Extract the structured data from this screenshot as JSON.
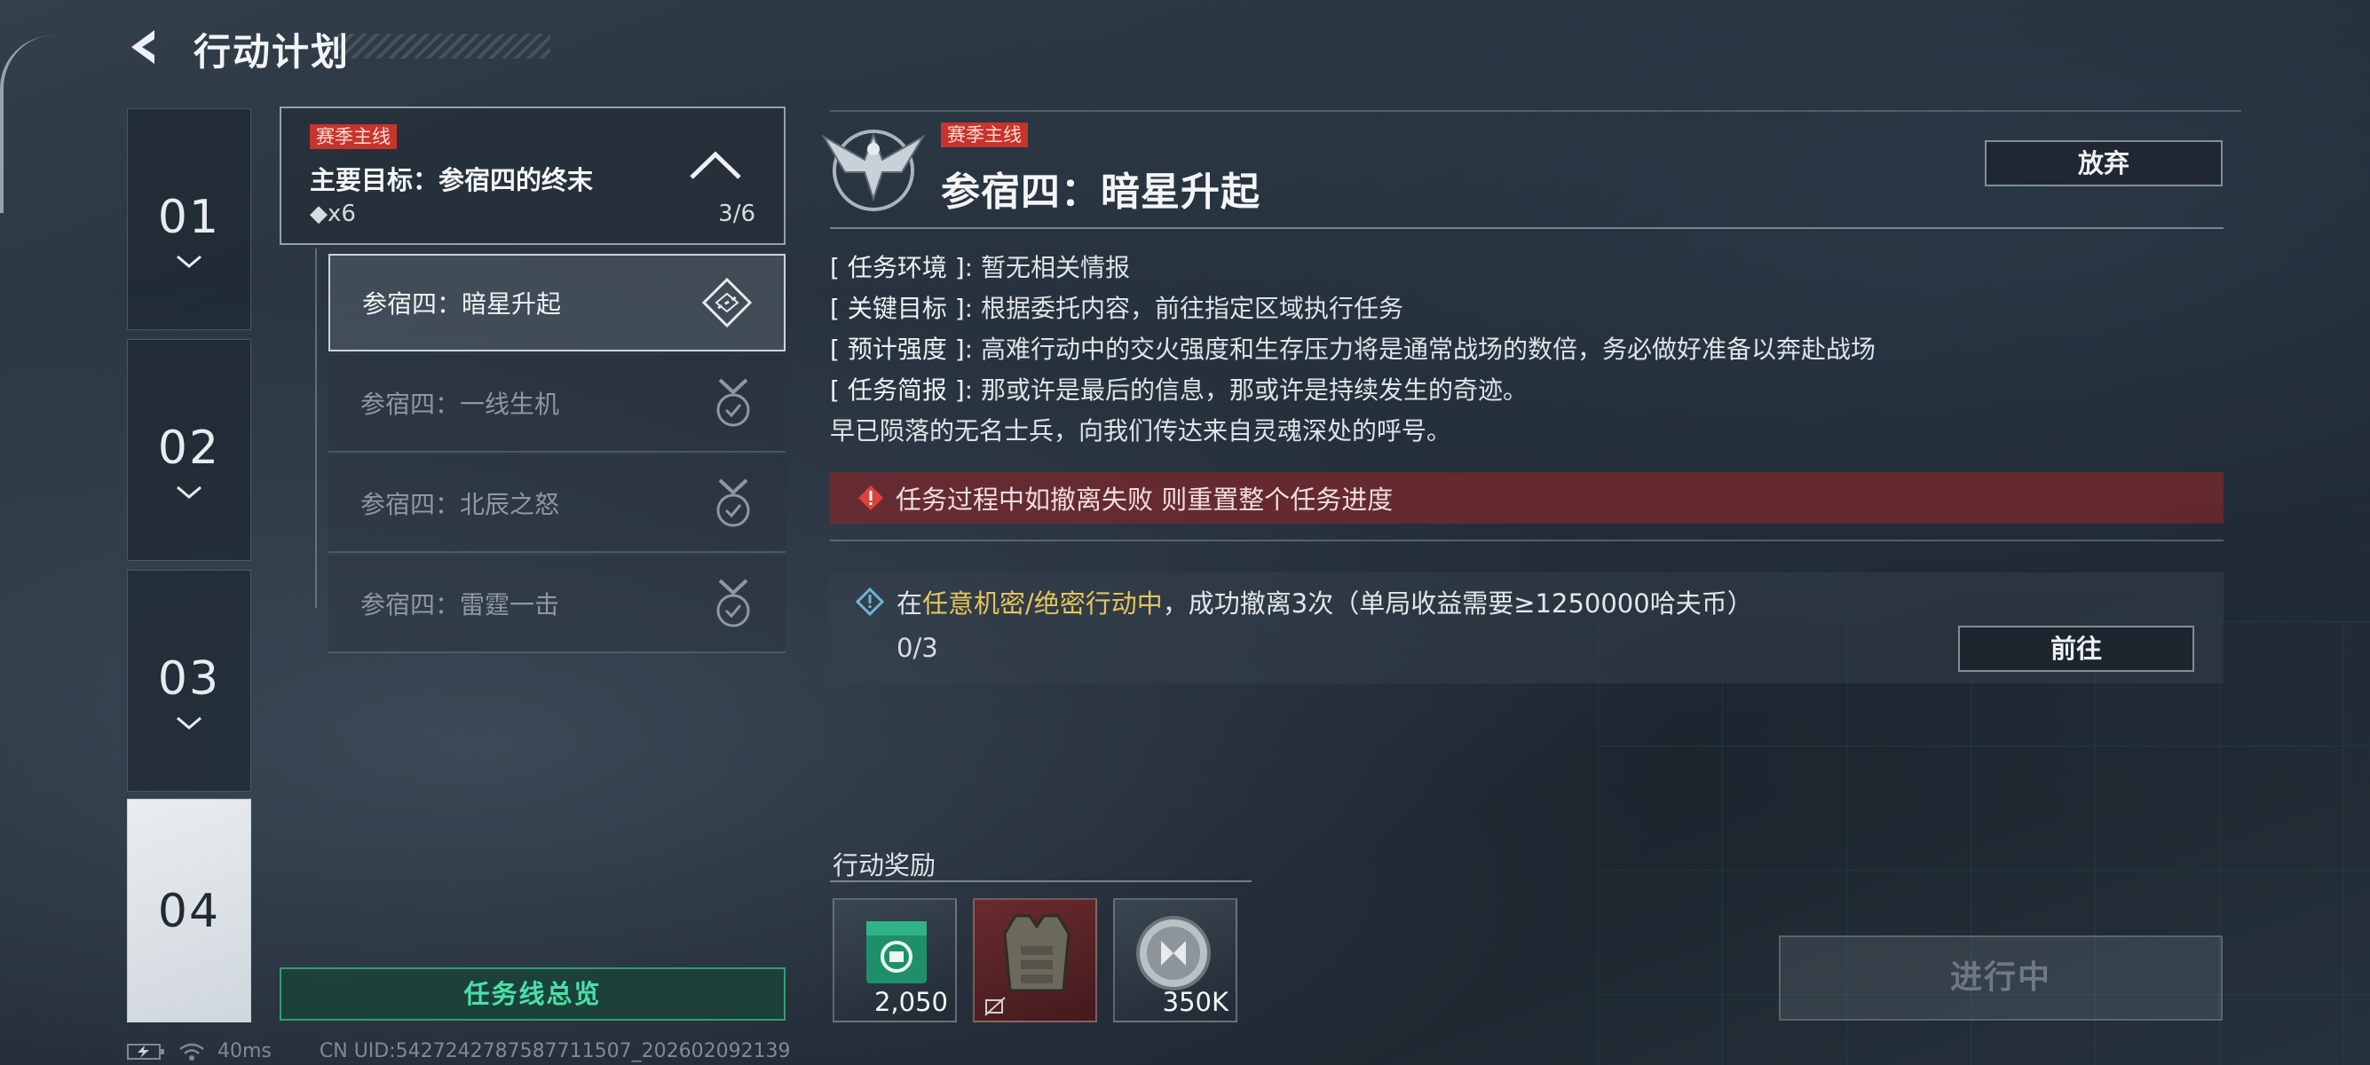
{
  "header": {
    "title": "行动计划"
  },
  "chapters": [
    {
      "label": "01",
      "active": false
    },
    {
      "label": "02",
      "active": false
    },
    {
      "label": "03",
      "active": false
    },
    {
      "label": "04",
      "active": true
    }
  ],
  "main_goal": {
    "tag": "赛季主线",
    "title": "主要目标：参宿四的终末",
    "reward": "◆x6",
    "progress": "3/6"
  },
  "sub_missions": [
    {
      "label": "参宿四：暗星升起",
      "icon": "hazard-diamond-icon",
      "selected": true
    },
    {
      "label": "参宿四：一线生机",
      "icon": "medal-check-icon",
      "selected": false
    },
    {
      "label": "参宿四：北辰之怒",
      "icon": "medal-check-icon",
      "selected": false
    },
    {
      "label": "参宿四：雷霆一击",
      "icon": "medal-check-icon",
      "selected": false
    }
  ],
  "overview_button": "任务线总览",
  "detail": {
    "tag": "赛季主线",
    "name": "参宿四：暗星升起",
    "abandon_label": "放弃",
    "info": [
      {
        "key": "[ 任务环境 ]",
        "value": ": 暂无相关情报"
      },
      {
        "key": "[ 关键目标 ]",
        "value": ": 根据委托内容，前往指定区域执行任务"
      },
      {
        "key": "[ 预计强度 ]",
        "value": ": 高难行动中的交火强度和生存压力将是通常战场的数倍，务必做好准备以奔赴战场"
      },
      {
        "key": "[ 任务简报 ]",
        "value": ": 那或许是最后的信息，那或许是持续发生的奇迹。"
      }
    ],
    "info_extra": "早已陨落的无名士兵，向我们传达来自灵魂深处的呼号。",
    "warning": "任务过程中如撤离失败 则重置整个任务进度",
    "task": {
      "prefix": "在",
      "highlight": "任意机密/绝密行动中",
      "suffix": "，成功撤离3次（单局收益需要≥1250000哈夫币）",
      "progress": "0/3",
      "go_label": "前往"
    }
  },
  "rewards": {
    "title": "行动奖励",
    "items": [
      {
        "icon": "green-cache-icon",
        "qty": "2,050"
      },
      {
        "icon": "body-armor-icon",
        "qty": ""
      },
      {
        "icon": "silver-coin-icon",
        "qty": "350K"
      }
    ]
  },
  "status_button": "进行中",
  "footer": {
    "ping": "40ms",
    "uid": "CN UID:5427242787587711507_202602092139"
  },
  "colors": {
    "tag_red": "#c6342d",
    "accent_green": "#49e0a8",
    "highlight_yellow": "#e6c45a",
    "warning_bg": "#7a282c"
  }
}
